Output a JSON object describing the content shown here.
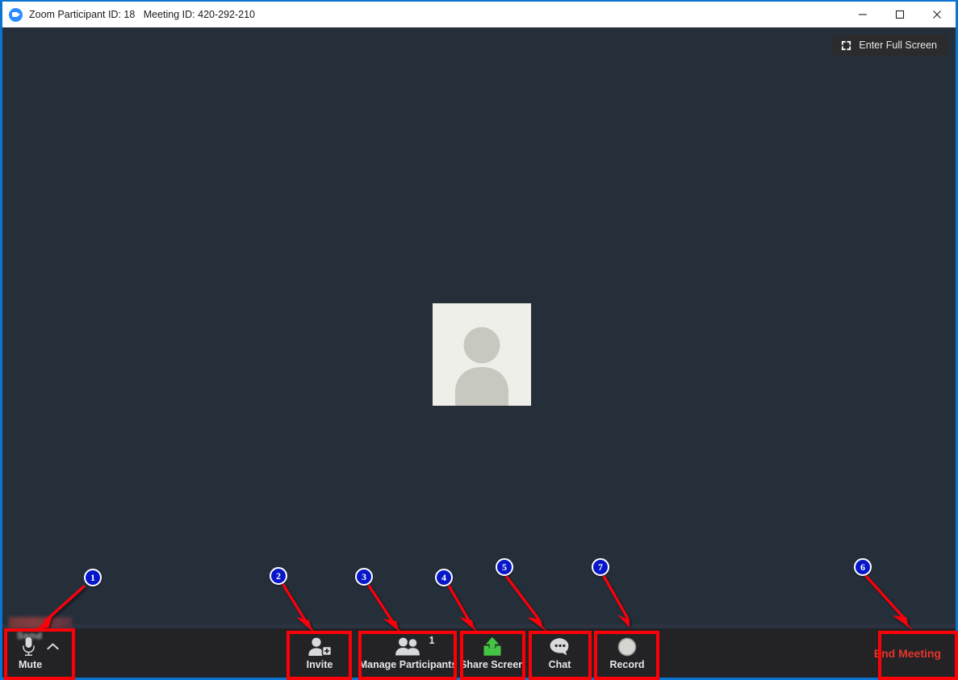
{
  "window": {
    "title": "Zoom Participant ID: 18   Meeting ID: 420-292-210",
    "participant_id": "18",
    "meeting_id": "420-292-210",
    "controls": {
      "minimize": "Minimize",
      "maximize": "Maximize",
      "close": "Close"
    },
    "accent_border_color": "#0b74d1",
    "titlebar_bg": "#ffffff"
  },
  "stage": {
    "background_color": "#252f3a",
    "fullscreen_button": {
      "label": "Enter Full Screen",
      "icon": "expand-icon"
    },
    "avatar": {
      "alt": "participant-avatar-placeholder",
      "background_color": "#efefe9",
      "silhouette_color": "#c7c9c0"
    }
  },
  "toolbar": {
    "background_color": "#232326",
    "top_strip_color": "#2b3340",
    "redacted_label": "Send",
    "buttons": [
      {
        "id": "mute",
        "label": "Mute",
        "icon": "microphone-icon",
        "has_caret": true
      },
      {
        "id": "invite",
        "label": "Invite",
        "icon": "person-add-icon",
        "has_caret": false
      },
      {
        "id": "manage",
        "label": "Manage Participants",
        "icon": "people-icon",
        "has_caret": false,
        "badge": "1"
      },
      {
        "id": "share",
        "label": "Share Screen",
        "icon": "share-screen-icon",
        "has_caret": false,
        "icon_color": "#44c544"
      },
      {
        "id": "chat",
        "label": "Chat",
        "icon": "chat-bubble-icon",
        "has_caret": false
      },
      {
        "id": "record",
        "label": "Record",
        "icon": "record-circle-icon",
        "has_caret": false
      }
    ],
    "end_meeting": {
      "label": "End Meeting",
      "color": "#e7342c"
    }
  },
  "annotations": {
    "marker_fill": "#0717c7",
    "marker_ring": "#ffffff",
    "arrow_color": "#fb0007",
    "highlight_color": "#fb0007",
    "markers": [
      {
        "number": "1",
        "target": "mute"
      },
      {
        "number": "2",
        "target": "invite"
      },
      {
        "number": "3",
        "target": "manage-participants"
      },
      {
        "number": "4",
        "target": "share-screen"
      },
      {
        "number": "5",
        "target": "chat"
      },
      {
        "number": "7",
        "target": "record"
      },
      {
        "number": "6",
        "target": "end-meeting"
      }
    ]
  }
}
